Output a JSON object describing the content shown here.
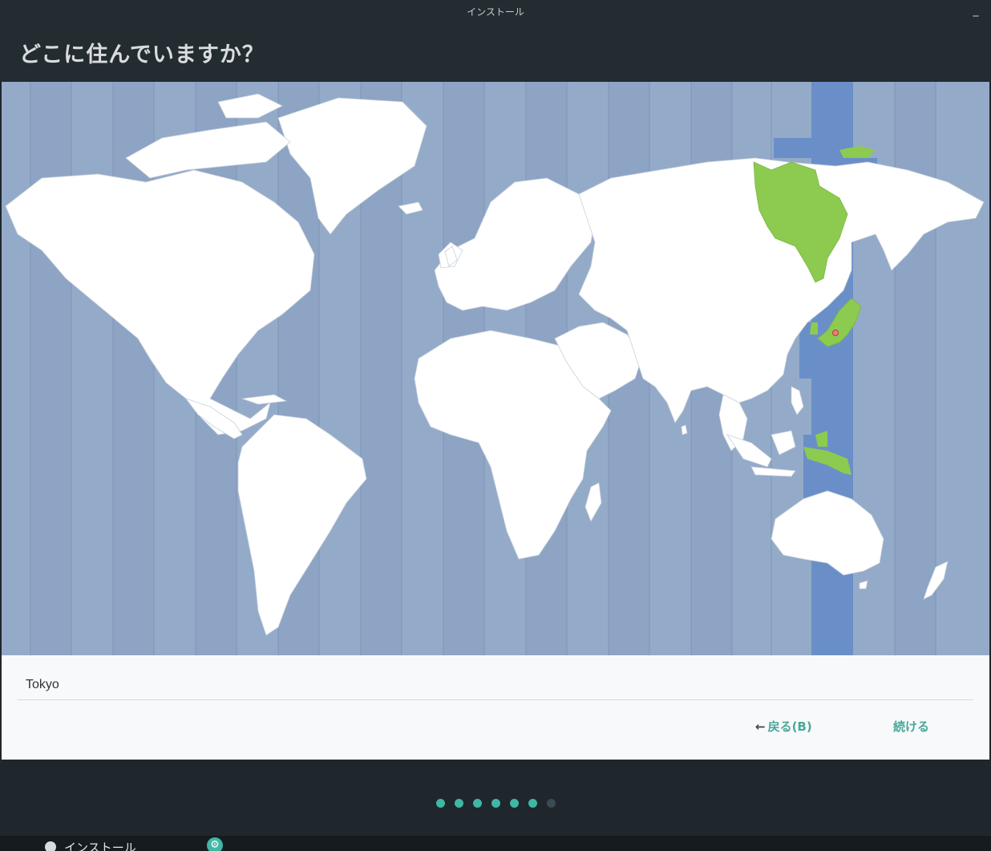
{
  "window": {
    "title": "インストール",
    "minimize_icon": "minimize-icon"
  },
  "header": {
    "title": "どこに住んでいますか？"
  },
  "map": {
    "selected_timezone_highlight": "#6a8fc8",
    "selected_country_color": "#8ccb4f",
    "ocean_color": "#94aac9",
    "land_color": "#ffffff",
    "marker": "location-pin-icon"
  },
  "location": {
    "value": "Tokyo"
  },
  "buttons": {
    "back_label": "戻る(B)",
    "continue_label": "続ける",
    "back_icon": "arrow-left-icon"
  },
  "progress": {
    "total_steps": 7,
    "current_step": 6
  },
  "taskbar": {
    "app_label": "インストール",
    "app_icon": "disc-icon",
    "tray_icon": "aperture-icon"
  },
  "colors": {
    "accent": "#3fb7a4",
    "header_bg": "#232c31",
    "window_bg": "#1f272d"
  }
}
